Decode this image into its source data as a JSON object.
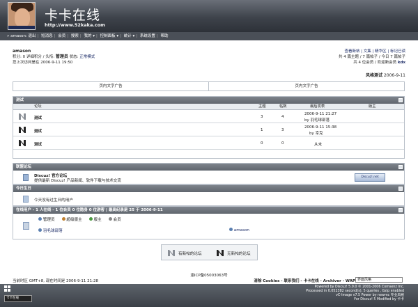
{
  "header": {
    "title": "卡卡在线",
    "url": "http://www.52kaka.com"
  },
  "nav": {
    "items": [
      "» amason: 退出",
      "短消息",
      "会员",
      "搜索",
      "我的 ▾",
      "控制面板 ▾",
      "统计 ▾",
      "系统设置",
      "帮助"
    ]
  },
  "user": {
    "name": "amason",
    "line1_prefix": "积分: 0 详细积分 / 头衔:",
    "rank": "管理员",
    "line1_suffix": "状态:",
    "mode": "正常模式",
    "line2": "您上次访问是在 2006-9-11 19:50"
  },
  "userlinks": {
    "line1": "查看新帖 | 文集 | 精华区 | 标记已读",
    "line2": "共 4 篇主题 / 7 篇帖子 / 今日 7 篇帖子",
    "line3": "共 4 位会员 / 欢迎新会员",
    "newmember": "kdx"
  },
  "style": {
    "label": "风格测试",
    "date": "2006-9-11"
  },
  "ads": {
    "left": "页内文字广告",
    "right": "页内文字广告"
  },
  "forums": {
    "category": "测试",
    "columns": {
      "name": "论坛",
      "topics": "主题",
      "posts": "帖数",
      "last": "最后发表",
      "mods": "版主"
    },
    "rows": [
      {
        "name": "测试",
        "topics": "3",
        "posts": "4",
        "last_date": "2006-9-11 21:27",
        "last_by": "by 羽毛球部落"
      },
      {
        "name": "测试",
        "topics": "1",
        "posts": "3",
        "last_date": "2006-9-11 15:38",
        "last_by": "by 幸克"
      },
      {
        "name": "测试",
        "topics": "0",
        "posts": "0",
        "last_date": "从未",
        "last_by": ""
      }
    ]
  },
  "links": {
    "title": "联盟论坛",
    "name": "Discuz! 官方论坛",
    "desc": "提供最新 Discuz! 产品新闻、软件下载与技术交流",
    "badge": "Discuz!.net"
  },
  "today": {
    "title": "今日生日",
    "text": "今天没有过生日的用户"
  },
  "online": {
    "title_prefix": "在线用户 - 1 人在线 - 1 位会员 0 位隐身 0 位游客 | 最高纪录是",
    "title_max": "25",
    "title_mid": "于",
    "title_date": "2006-9-11",
    "legend": [
      "管理员",
      "超级版主",
      "版主",
      "会员"
    ],
    "users": [
      "羽毛球部落",
      "amason"
    ]
  },
  "legend": {
    "new": "有新帖的论坛",
    "nonew": "无新帖的论坛"
  },
  "footer": {
    "icp": "渝ICP备05003063号",
    "timezone": "当前时区 GMT+8, 现在时间是 2006-9-11 21:28",
    "links": "清除 Cookies - 联系我们 - 卡卡在线 - Archiver - WAP",
    "select": "界面风格",
    "copy1": "Powered by Discuz! 5.0.0 © 2001-2006 Comsenz Inc.",
    "copy2": "Processed in 0.052382 second(s), 5 queries , Gzip enabled",
    "copy3": "vC-Image v7.5 Power by newmc 专业风格",
    "copy4": "For Discuz! 5 Modified by 卡卡",
    "badge": "卡卡在线"
  }
}
